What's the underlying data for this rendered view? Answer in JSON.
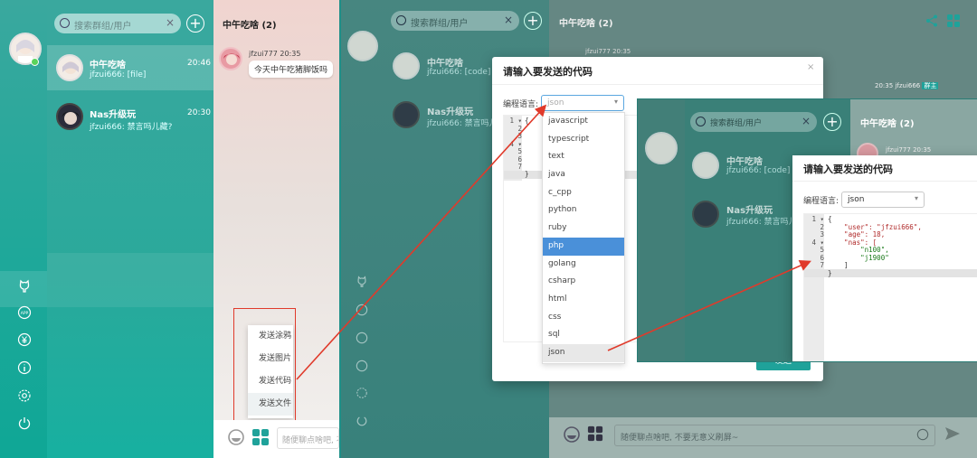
{
  "search": {
    "placeholder": "搜索群组/用户"
  },
  "conversations": [
    {
      "name": "中午吃啥",
      "preview": "jfzui666: [file]",
      "time": "20:46"
    },
    {
      "name": "Nas升级玩",
      "preview": "jfzui666: 禁言吗儿藏?",
      "time": "20:30"
    }
  ],
  "conversations_inset": [
    {
      "name": "中午吃啥",
      "preview": "jfzui666: [code]"
    },
    {
      "name": "Nas升级玩",
      "preview": "jfzui666: 禁言吗儿藏?"
    }
  ],
  "chat": {
    "title": "中午吃啥 (2)",
    "message": {
      "user": "jfzui777",
      "time": "20:35",
      "text": "今天中午吃猪脚饭吗"
    },
    "right_message": {
      "time": "20:35",
      "user": "jfzui666",
      "badge": "群主"
    },
    "input_placeholder": "随便聊点啥吧, 不要无意义刷屏~",
    "input_placeholder_short": "随便聊点啥吧, 不"
  },
  "send_menu": [
    "发送涂鸦",
    "发送图片",
    "发送代码",
    "发送文件"
  ],
  "code_modal": {
    "title": "请输入要发送的代码",
    "lang_label": "编程语言:",
    "lang_value": "json",
    "send_label": "发送",
    "close": "×"
  },
  "languages": [
    "javascript",
    "typescript",
    "text",
    "java",
    "c_cpp",
    "python",
    "ruby",
    "php",
    "golang",
    "csharp",
    "html",
    "css",
    "sql",
    "json"
  ],
  "editor": {
    "line_numbers": [
      "1 ▾",
      "2",
      "3",
      "4 ▾",
      "5",
      "6",
      "7",
      "8"
    ],
    "lines": [
      "{",
      "    \"user\": \"jfzui666\",",
      "    \"age\": 18,",
      "    \"nas\": [",
      "        \"n100\",",
      "        \"j1900\"",
      "    ]",
      "}"
    ]
  },
  "colors": {
    "teal": "#1fa29a",
    "red_arrow": "#e03a2b",
    "dropdown_active": "#4a90d9"
  }
}
